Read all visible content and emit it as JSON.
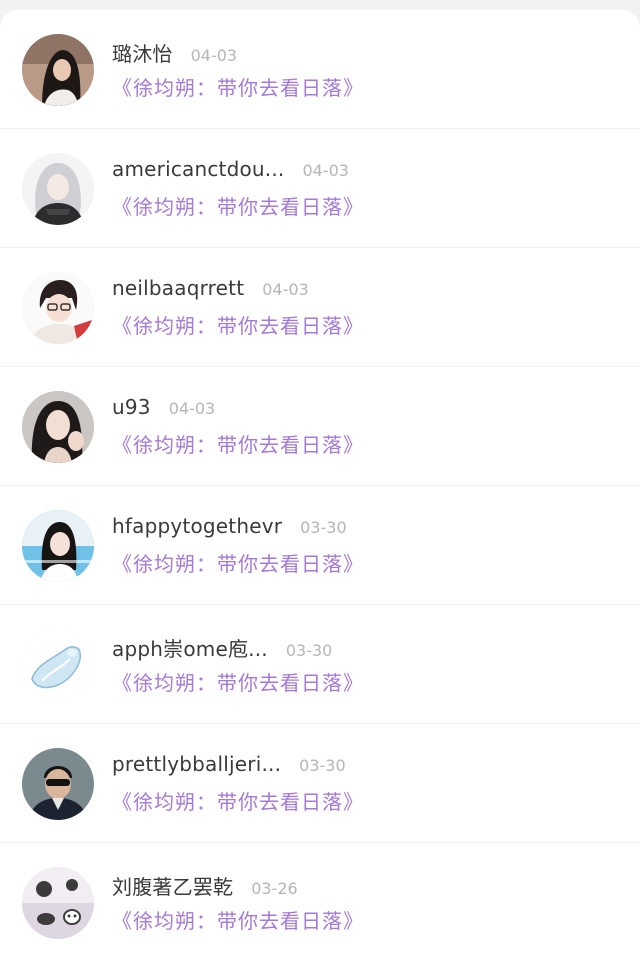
{
  "comments": [
    {
      "name": "璐沐怡",
      "date": "04-03",
      "song": "《徐均朔：带你去看日落》",
      "avatar_icon": "avatar-woman-dark-hair-icon"
    },
    {
      "name": "americanctdou...",
      "date": "04-03",
      "song": "《徐均朔：带你去看日落》",
      "avatar_icon": "avatar-anime-girl-grey-hair-icon"
    },
    {
      "name": "neilbaaqrrett",
      "date": "04-03",
      "song": "《徐均朔：带你去看日落》",
      "avatar_icon": "avatar-anime-boy-glasses-icon"
    },
    {
      "name": "u93",
      "date": "04-03",
      "song": "《徐均朔：带你去看日落》",
      "avatar_icon": "avatar-woman-selfie-icon"
    },
    {
      "name": "hfappytogethevr",
      "date": "03-30",
      "song": "《徐均朔：带你去看日落》",
      "avatar_icon": "avatar-girl-blue-background-icon"
    },
    {
      "name": "apph崇ome庖...",
      "date": "03-30",
      "song": "《徐均朔：带你去看日落》",
      "avatar_icon": "avatar-glass-shoe-icon"
    },
    {
      "name": "prettlybballjeri...",
      "date": "03-30",
      "song": "《徐均朔：带你去看日落》",
      "avatar_icon": "avatar-man-sunglasses-icon"
    },
    {
      "name": "刘腹著乙罢乾",
      "date": "03-26",
      "song": "《徐均朔：带你去看日落》",
      "avatar_icon": "avatar-cartoon-pattern-icon"
    }
  ],
  "colors": {
    "song_link": "#a57ad6",
    "name_text": "#3a3a3a",
    "date_text": "#b6b6b6"
  }
}
